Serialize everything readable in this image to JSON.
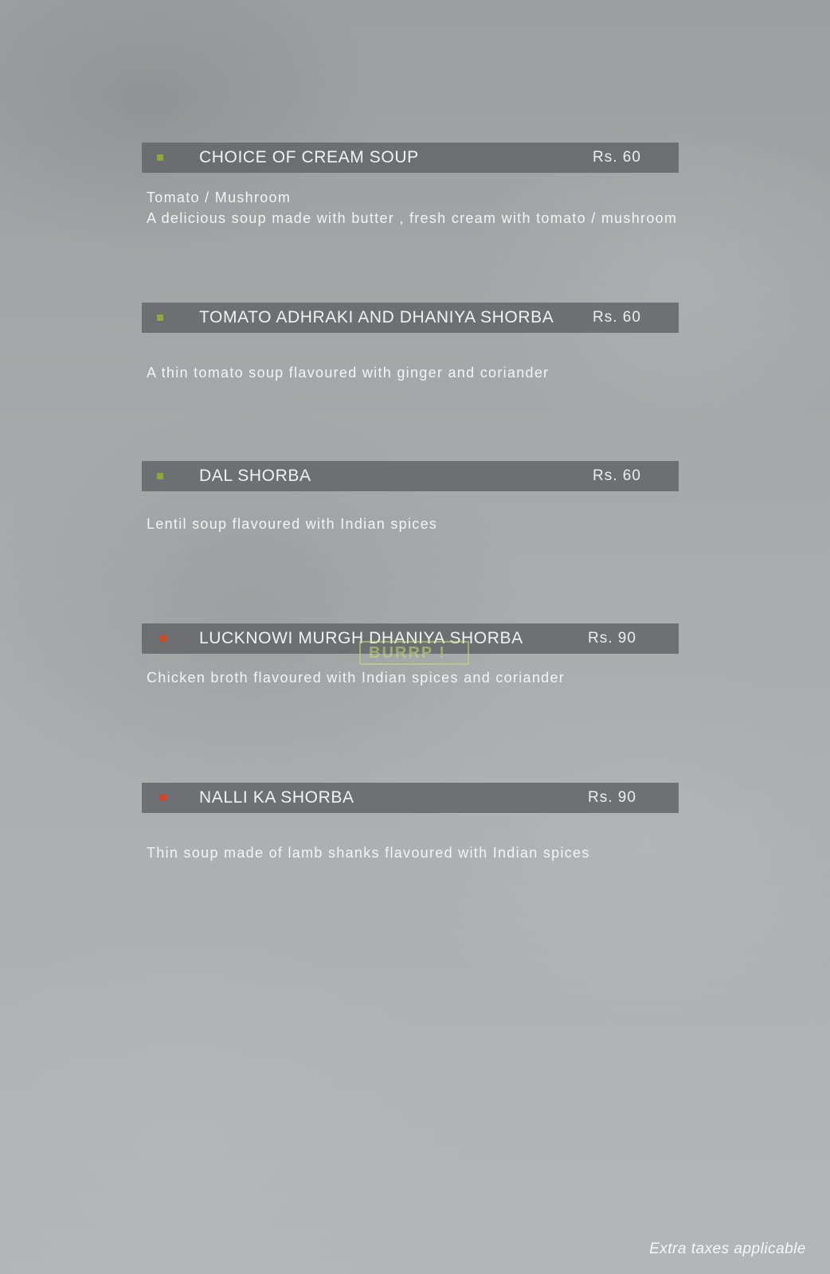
{
  "items": [
    {
      "name": "CHOICE OF CREAM SOUP",
      "price": "Rs. 60",
      "bullet_color": "#8fa83a",
      "description": [
        "Tomato / Mushroom",
        "A delicious soup made with butter , fresh cream with tomato / mushroom"
      ]
    },
    {
      "name": "TOMATO ADHRAKI AND DHANIYA SHORBA",
      "price": "Rs. 60",
      "bullet_color": "#8fa83a",
      "description": [
        "A thin tomato soup flavoured with ginger and coriander"
      ]
    },
    {
      "name": "DAL SHORBA",
      "price": "Rs. 60",
      "bullet_color": "#8fa83a",
      "description": [
        "Lentil soup flavoured with Indian spices"
      ]
    },
    {
      "name": "LUCKNOWI MURGH DHANIYA SHORBA",
      "price": "Rs. 90",
      "bullet_color": "#d9441c",
      "description": [
        "Chicken broth flavoured with Indian spices and coriander"
      ]
    },
    {
      "name": "NALLI KA SHORBA",
      "price": "Rs. 90",
      "bullet_color": "#d9441c",
      "description": [
        "Thin soup made of lamb shanks flavoured with Indian spices"
      ]
    }
  ],
  "watermark": "BURRP !",
  "footer": "Extra taxes applicable"
}
